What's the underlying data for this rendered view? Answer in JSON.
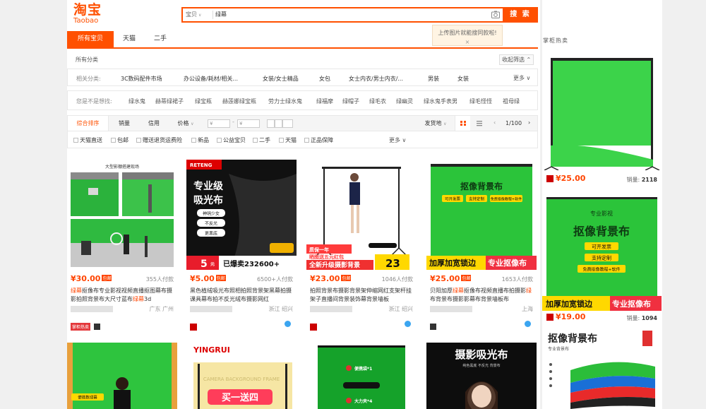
{
  "logo": {
    "cn": "淘宝",
    "en": "Taobao"
  },
  "search": {
    "type": "宝贝",
    "query": "绿幕",
    "button": "搜 索",
    "tip": "上传图片就能搜同款啦!",
    "tip_close": "×"
  },
  "tabs": [
    "所有宝贝",
    "天猫",
    "二手"
  ],
  "category": {
    "label": "所有分类",
    "collapse": "收起筛选"
  },
  "related": {
    "label": "相关分类:",
    "items": [
      "3C数码配件市场",
      "办公设备/耗材/相关...",
      "女装/女士精品",
      "女包",
      "女士内衣/男士内衣/...",
      "男装",
      "女装"
    ],
    "more": "更多"
  },
  "suggest": {
    "label": "您是不是想找:",
    "items": [
      "绿水鬼",
      "赫蒂绿裙子",
      "绿宝瓶",
      "赫莲娜绿宝瓶",
      "劳力士绿水鬼",
      "绿福摩",
      "绿帽子",
      "绿毛衣",
      "绿幽灵",
      "绿水鬼手表男",
      "绿毛怪怪",
      "祖母绿"
    ]
  },
  "sort": {
    "items": [
      "综合排序",
      "销量",
      "信用",
      "价格"
    ],
    "price_from": "¥",
    "price_to": "¥",
    "ship_from": "发货地",
    "page": "1/100"
  },
  "checks": [
    "天猫直送",
    "包邮",
    "赠送退货运费险",
    "新品",
    "公益宝贝",
    "二手",
    "天猫",
    "正品保障"
  ],
  "checks_more": "更多",
  "products": [
    {
      "price": "¥30.00",
      "baoyou": "包邮",
      "sales": "355人付款",
      "title_hl": "绿幕",
      "title": "抠像布专业影视视频直播抠图幕布摄影拍照背景布大尺寸蓝布",
      "title_hl2": "绿幕",
      "title_end": "3d",
      "loc": "广东 广州",
      "badge": "掌柜热卖",
      "img_head": "大型影棚搭建现场"
    },
    {
      "price": "¥5.00",
      "baoyou": "包邮",
      "sales": "6500+人付款",
      "title": "黑色植绒吸光布照相拍照背景架黑幕拍摄课具幕布拍不反光绒布摄影网红",
      "loc": "浙江 绍兴",
      "img_brand": "RETENG",
      "img_t1": "专业级",
      "img_t2": "吸光布",
      "img_b1": "神明少女",
      "img_b2": "不反光",
      "img_b3": "更黑底",
      "img_price": "5",
      "img_price_unit": "元",
      "img_sale": "已爆卖232600+"
    },
    {
      "price": "¥23.00",
      "baoyou": "包邮",
      "sales": "1046人付款",
      "title": "拍照背景布摄影背景架伸缩网红支架杆挂架子直播间背景装饰幕背景墙板",
      "loc": "浙江 绍兴",
      "img_t1": "质保一年",
      "img_t2": "晒图送五元红包",
      "img_t3": "全新升级摄影背景",
      "img_price": "23"
    },
    {
      "price": "¥25.00",
      "baoyou": "包邮",
      "sales": "1653人付款",
      "title_pre": "贝阳加厚",
      "title_hl": "绿幕",
      "title": "抠像布视频直播布拍摄影",
      "title_hl2": "绿",
      "title_end": "布背景布摄影影幕布背景墙板布",
      "loc": "上海",
      "img_t1": "抠像背景布",
      "img_t2": "可开发票",
      "img_t3": "支持定制",
      "img_t4": "免费抠像教程+软件",
      "img_t5": "加厚加宽锁边",
      "img_t6": "专业抠像布"
    },
    {
      "img_t1": "便携数绿幕"
    },
    {
      "img_brand": "YINGRUI",
      "img_t1": "CAMERA BACKGROUND FRAME",
      "img_t2": "买一送四"
    },
    {
      "img_t1": "便携袋*1",
      "img_t2": "大力夹*4"
    },
    {
      "img_t1": "摄影吸光布",
      "img_t2": "纯色黑底  不反光  背景布"
    }
  ],
  "side": {
    "title": "掌柜热卖",
    "items": [
      {
        "price": "¥25.00",
        "sales_label": "销量:",
        "sales": "2118"
      },
      {
        "price": "¥19.00",
        "sales_label": "销量:",
        "sales": "1094",
        "img_t0": "专业影视",
        "img_t1": "抠像背景布",
        "img_t2": "可开发票",
        "img_t3": "支持定制",
        "img_t4": "免费抠像教程+软件",
        "img_t5": "加厚加宽锁边",
        "img_t6": "专业抠像布"
      },
      {
        "img_t1": "抠像背景布",
        "img_t2": "专业背景布"
      }
    ]
  },
  "colors": {
    "accent": "#ff5000",
    "green": "#2bc43a",
    "price": "#ff4400"
  }
}
